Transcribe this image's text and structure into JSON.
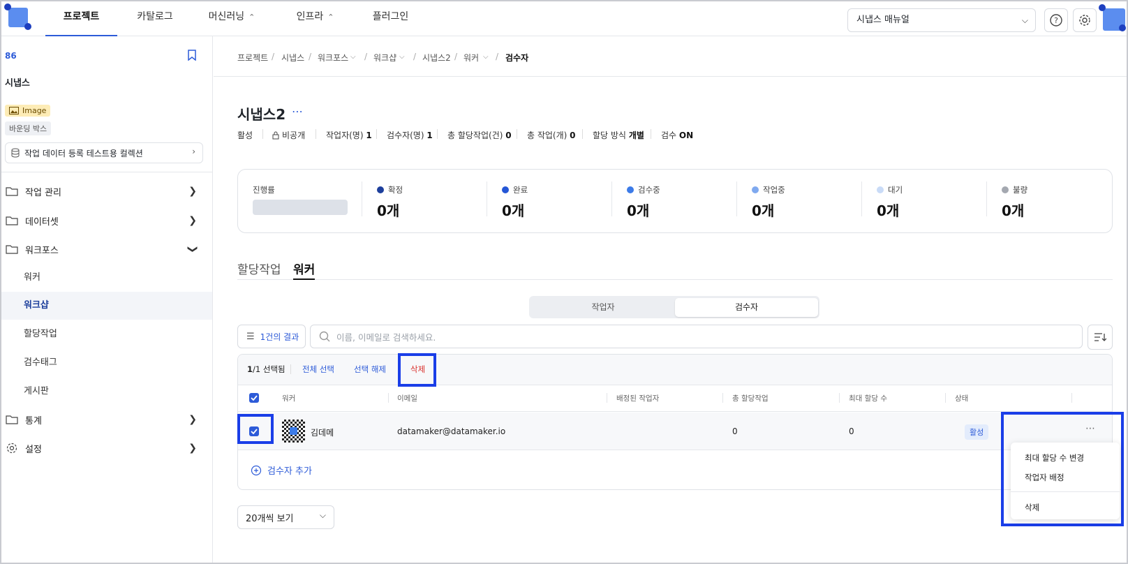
{
  "topnav": {
    "tabs": [
      "프로젝트",
      "카탈로그",
      "머신러닝",
      "인프라",
      "플러그인"
    ],
    "manual_select": "시냅스 매뉴얼"
  },
  "sidebar": {
    "project_id": "86",
    "project_name": "시냅스",
    "badge_image": "Image",
    "badge_bbox": "바운딩 박스",
    "collection": "작업 데이터 등록 테스트용 컬렉션",
    "items": [
      "작업 관리",
      "데이터셋",
      "워크포스"
    ],
    "workforce_sub": [
      "워커",
      "워크샵",
      "할당작업",
      "검수태그",
      "게시판"
    ],
    "bottom_items": [
      "통계",
      "설정"
    ]
  },
  "breadcrumb": [
    "프로젝트",
    "시냅스",
    "워크포스",
    "워크샵",
    "시냅스2",
    "워커",
    "검수자"
  ],
  "workshop": {
    "title": "시냅스2",
    "status": "활성",
    "visibility": "비공개",
    "workers_label": "작업자(명)",
    "workers_count": "1",
    "reviewers_label": "검수자(명)",
    "reviewers_count": "1",
    "total_assigned_label": "총 할당작업(건)",
    "total_assigned": "0",
    "total_tasks_label": "총 작업(개)",
    "total_tasks": "0",
    "assign_method_label": "할당 방식",
    "assign_method": "개별",
    "review_label": "검수",
    "review_value": "ON"
  },
  "progress": {
    "label": "진행률",
    "stats": [
      {
        "label": "확정",
        "value": "0개",
        "color": "#1d3f9c"
      },
      {
        "label": "완료",
        "value": "0개",
        "color": "#2456d6"
      },
      {
        "label": "검수중",
        "value": "0개",
        "color": "#3c7be8"
      },
      {
        "label": "작업중",
        "value": "0개",
        "color": "#7fa9ef"
      },
      {
        "label": "대기",
        "value": "0개",
        "color": "#c9dbf7"
      },
      {
        "label": "불량",
        "value": "0개",
        "color": "#a4a8b0"
      }
    ]
  },
  "tabs": [
    "할당작업",
    "워커"
  ],
  "segment": [
    "작업자",
    "검수자"
  ],
  "filter": {
    "count": "1건의 결과",
    "search_placeholder": "이름, 이메일로 검색하세요."
  },
  "selection": {
    "selected_num": "1",
    "selected_total": "/1 선택됨",
    "select_all": "전체 선택",
    "deselect": "선택 해제",
    "delete": "삭제"
  },
  "table": {
    "headers": [
      "워커",
      "이메일",
      "배정된 작업자",
      "총 할당작업",
      "최대 할당 수",
      "상태"
    ],
    "rows": [
      {
        "name": "김데메",
        "email": "datamaker@datamaker.io",
        "assigned_workers": "",
        "total_assigned": "0",
        "max_assign": "0",
        "status": "활성"
      }
    ],
    "add_label": "검수자 추가"
  },
  "context_menu": [
    "최대 할당 수 변경",
    "작업자 배정",
    "삭제"
  ],
  "pagination": {
    "page_size": "20개씩 보기"
  },
  "colors": {
    "accent": "#2d5bd8",
    "highlight": "#1a3ee8",
    "danger": "#d9302c"
  }
}
